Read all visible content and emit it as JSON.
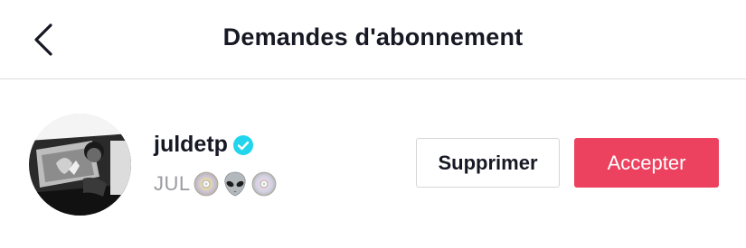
{
  "header": {
    "title": "Demandes d'abonnement",
    "back_icon": "chevron-left-icon"
  },
  "request": {
    "username": "juldetp",
    "verified": true,
    "verified_color": "#20d5ec",
    "nickname": "JUL",
    "nickname_emojis": [
      "cd-disc-icon",
      "alien-icon",
      "cd-disc-icon"
    ],
    "delete_label": "Supprimer",
    "accept_label": "Accepter",
    "accept_color": "#ec4260"
  }
}
